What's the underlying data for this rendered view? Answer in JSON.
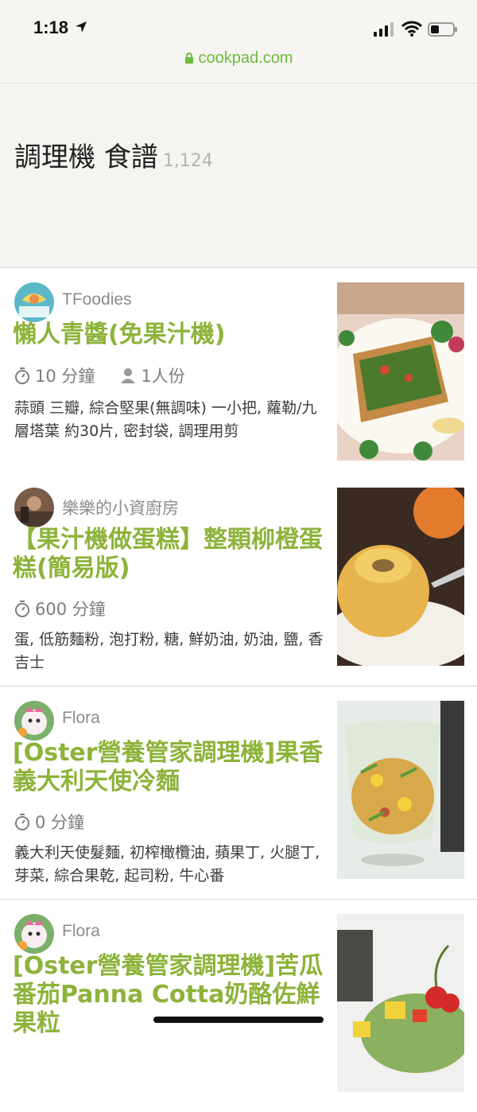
{
  "status_bar": {
    "time": "1:18"
  },
  "browser": {
    "url": "cookpad.com"
  },
  "page": {
    "title": "調理機 食譜",
    "count": "1,124"
  },
  "recipes": [
    {
      "author": "TFoodies",
      "title": "懶人青醬(免果汁機)",
      "time": "10 分鐘",
      "servings": "1人份",
      "ingredients": "蒜頭 三瓣, 綜合堅果(無調味) 一小把, 蘿勒/九層塔葉 約30片, 密封袋, 調理用剪"
    },
    {
      "author": "樂樂的小資廚房",
      "title": "【果汁機做蛋糕】整顆柳橙蛋糕(簡易版)",
      "time": "600 分鐘",
      "servings": "",
      "ingredients": "蛋, 低筋麵粉, 泡打粉, 糖, 鮮奶油, 奶油, 鹽, 香吉士"
    },
    {
      "author": "Flora",
      "title": "[Oster營養管家調理機]果香義大利天使冷麵",
      "time": "0 分鐘",
      "servings": "",
      "ingredients": "義大利天使髮麵, 初榨橄欖油, 蘋果丁, 火腿丁, 芽菜, 綜合果乾, 起司粉, 牛心番"
    },
    {
      "author": "Flora",
      "title": "[Oster營養管家調理機]苦瓜番茄Panna Cotta奶酪佐鮮果粒",
      "time": "",
      "servings": "",
      "ingredients": ""
    }
  ],
  "colors": {
    "title_green": "#8db33a",
    "url_green": "#6cbb3c"
  }
}
